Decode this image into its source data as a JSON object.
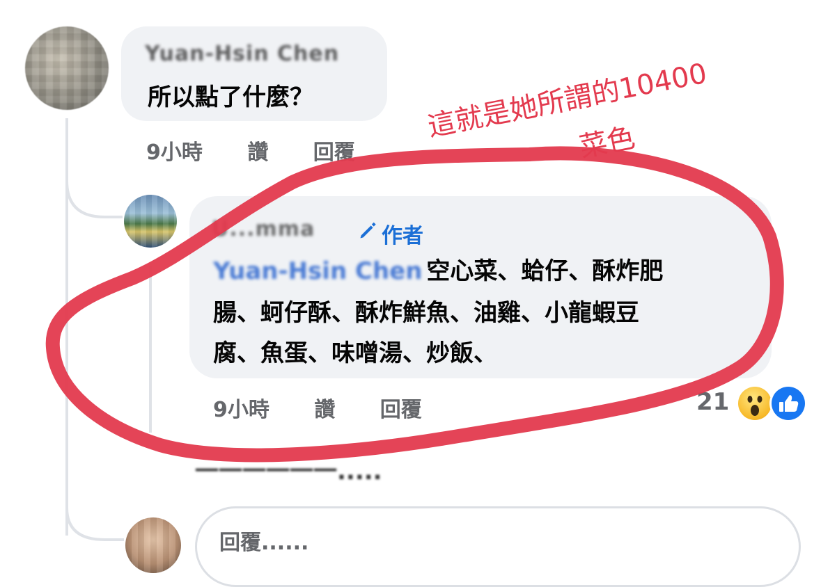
{
  "comment_1": {
    "author_name": "Yuan-Hsin Chen",
    "text": "所以點了什麼？",
    "time": "9小時",
    "like_label": "讚",
    "reply_label": "回覆"
  },
  "comment_2": {
    "author_name": "U...mma",
    "author_badge": "作者",
    "mention": "Yuan-Hsin Chen",
    "text_line_1": "空心菜、蛤仔、酥炸肥",
    "text_line_2": "腸、蚵仔酥、酥炸鮮魚、油雞、小龍蝦豆",
    "text_line_3": "腐、魚蛋、味噌湯、炒飯、",
    "time": "9小時",
    "like_label": "讚",
    "reply_label": "回覆",
    "reaction_count": "21",
    "reactions": [
      "wow-icon",
      "like-icon"
    ]
  },
  "hidden_comment_text": "一一一一一一.....",
  "reply_box": {
    "placeholder": "回覆......"
  },
  "annotation": {
    "line_1": "這就是她所謂的10400",
    "line_2": "菜色",
    "color": "#e33a4e"
  }
}
